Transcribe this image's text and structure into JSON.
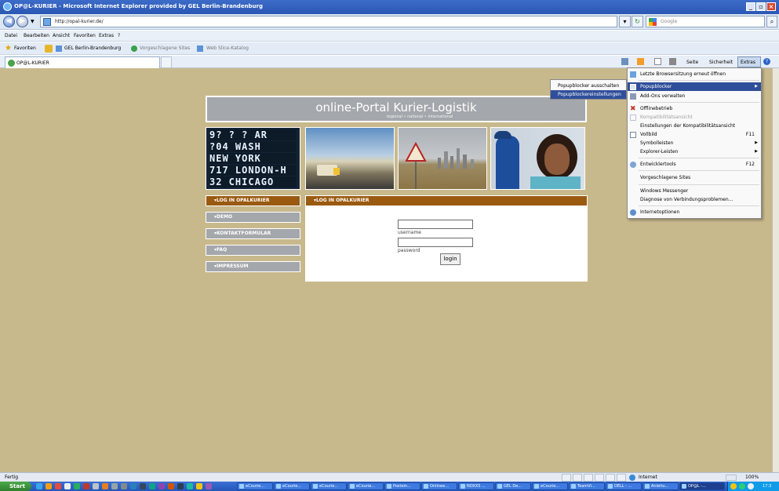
{
  "window": {
    "title": "OP@L-KURIER - Microsoft Internet Explorer provided by GEL Berlin-Brandenburg"
  },
  "address_bar": {
    "url": "http://opal-kurier.de/",
    "search_placeholder": "Google"
  },
  "menu_bar": {
    "items": [
      "Datei",
      "Bearbeiten",
      "Ansicht",
      "Favoriten",
      "Extras",
      "?"
    ]
  },
  "favorites_bar": {
    "favorites_label": "Favoriten",
    "links": [
      "GEL Berlin-Brandenburg",
      "Vorgeschlagene Sites",
      "Web Slice-Katalog"
    ]
  },
  "tab": {
    "label": "OP@L-KURIER"
  },
  "command_bar": {
    "seite": "Seite",
    "sicherheit": "Sicherheit",
    "extras": "Extras"
  },
  "portal": {
    "title": "online-Portal Kurier-Logistik",
    "subtitle": "regional • national • international",
    "board_lines": [
      "9? ? ? AR",
      "?04 WASH",
      "NEW YORK",
      "717 LONDON-H",
      "32 CHICAGO"
    ],
    "left_menu": [
      "LOG IN OPALKURIER",
      "DEMO",
      "KONTAKTFORMULAR",
      "FAQ",
      "IMPRESSUM"
    ],
    "login_header": "LOG IN OPALKURIER",
    "username_label": "username",
    "password_label": "password",
    "login_button": "login"
  },
  "extras_menu": {
    "items": [
      {
        "label": "Letzte Browsersitzung erneut öffnen",
        "shortcut": ""
      },
      {
        "label": "Popupblocker",
        "shortcut": "",
        "submenu": true,
        "highlighted": true
      },
      {
        "label": "Add-Ons verwalten",
        "shortcut": ""
      },
      {
        "label": "Offlinebetrieb",
        "shortcut": ""
      },
      {
        "label": "Kompatibilitätsansicht",
        "shortcut": "",
        "disabled": true
      },
      {
        "label": "Einstellungen der Kompatibilitätsansicht",
        "shortcut": ""
      },
      {
        "label": "Vollbild",
        "shortcut": "F11"
      },
      {
        "label": "Symbolleisten",
        "shortcut": "",
        "submenu": true
      },
      {
        "label": "Explorer-Leisten",
        "shortcut": "",
        "submenu": true
      },
      {
        "label": "Entwicklertools",
        "shortcut": "F12"
      },
      {
        "label": "Vorgeschlagene Sites",
        "shortcut": ""
      },
      {
        "label": "Windows Messenger",
        "shortcut": ""
      },
      {
        "label": "Diagnose von Verbindungsproblemen...",
        "shortcut": ""
      },
      {
        "label": "Internetoptionen",
        "shortcut": ""
      }
    ]
  },
  "popup_submenu": {
    "items": [
      "Popupblocker ausschalten",
      "Popupblockereinstellungen"
    ]
  },
  "status_bar": {
    "status": "Fertig",
    "zone": "Internet",
    "zoom": "100%"
  },
  "taskbar": {
    "start": "Start",
    "buttons": [
      "eCourie...",
      "eCourie...",
      "eCourie...",
      "eCourie...",
      "Postein...",
      "Onlinee...",
      "NOXXS ...",
      "GEL De...",
      "eCourie...",
      "TeamVi...",
      "DELL - ...",
      "Anleitu...",
      "OP@L -..."
    ],
    "clock": "17:3"
  }
}
